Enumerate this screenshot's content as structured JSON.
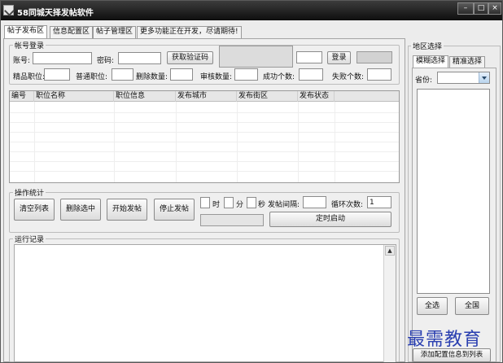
{
  "window": {
    "title": "58同城天择发帖软件",
    "minimize": "–",
    "maximize": "□",
    "close": "×"
  },
  "tabs": [
    "帖子发布区",
    "信息配置区",
    "帖子管理区",
    "更多功能正在开发，尽请期待!"
  ],
  "login": {
    "legend": "帐号登录",
    "account_label": "账号:",
    "password_label": "密码:",
    "captcha_button": "获取验证码",
    "login_button": "登录",
    "premium_label": "精品职位:",
    "normal_label": "普通职位:",
    "deleted_label": "删除数量:",
    "review_label": "审核数量:",
    "success_label": "成功个数:",
    "fail_label": "失败个数:"
  },
  "table": {
    "columns": [
      "编号",
      "职位名称",
      "职位信息",
      "发布城市",
      "发布街区",
      "发布状态"
    ]
  },
  "stats": {
    "legend": "操作统计",
    "buttons": [
      "清空列表",
      "删除选中",
      "开始发帖",
      "停止发帖"
    ],
    "hour": "时",
    "minute": "分",
    "second": "秒",
    "interval_label": "发帖间隔:",
    "loop_label": "循环次数:",
    "loop_value": "1",
    "schedule_button": "定时启动"
  },
  "log": {
    "legend": "运行记录"
  },
  "region": {
    "legend": "地区选择",
    "tabs": [
      "模糊选择",
      "精准选择"
    ],
    "province_label": "省份:",
    "select_all": "全选",
    "whole_country": "全国",
    "add_config": "添加配置信息到列表"
  },
  "watermark": "最需教育"
}
